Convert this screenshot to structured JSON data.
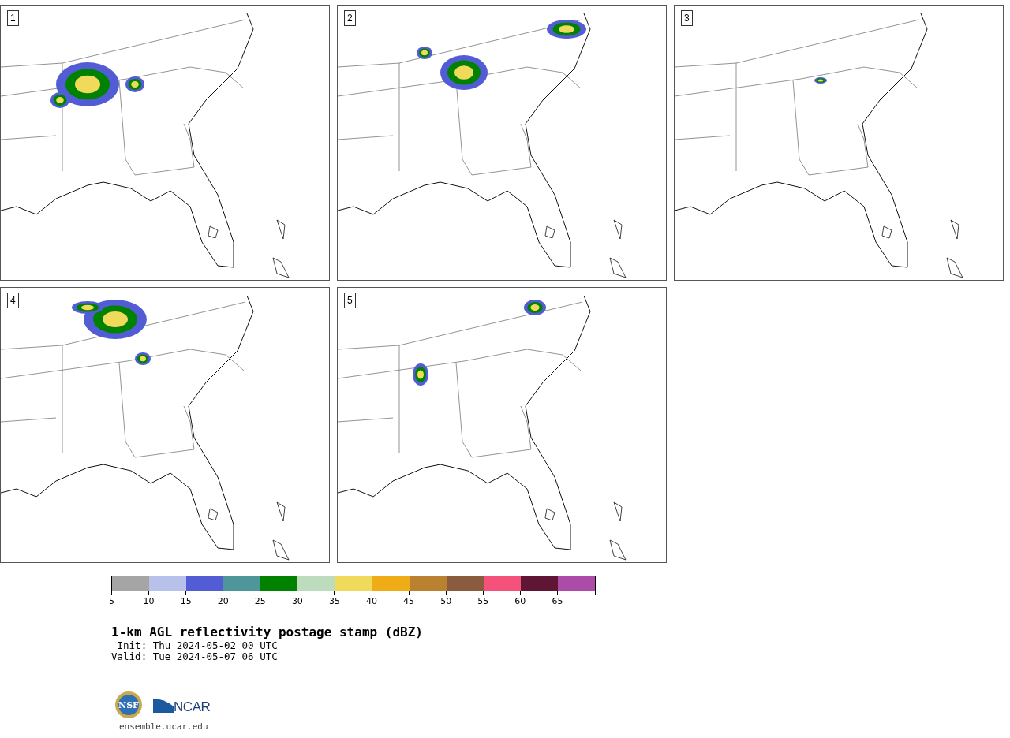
{
  "panels": [
    {
      "label": "1"
    },
    {
      "label": "2"
    },
    {
      "label": "3"
    },
    {
      "label": "4"
    },
    {
      "label": "5"
    }
  ],
  "colorbar": {
    "bins": [
      {
        "label": "5",
        "color": "#a5a5a5"
      },
      {
        "label": "10",
        "color": "#b7c1ea"
      },
      {
        "label": "15",
        "color": "#525dd5"
      },
      {
        "label": "20",
        "color": "#4e9699"
      },
      {
        "label": "25",
        "color": "#008200"
      },
      {
        "label": "30",
        "color": "#bddcbd"
      },
      {
        "label": "35",
        "color": "#f0da5c"
      },
      {
        "label": "40",
        "color": "#f0ac17"
      },
      {
        "label": "45",
        "color": "#b98130"
      },
      {
        "label": "50",
        "color": "#8a5b3e"
      },
      {
        "label": "55",
        "color": "#f4527a"
      },
      {
        "label": "60",
        "color": "#5f1634"
      },
      {
        "label": "65",
        "color": "#ad4ba8"
      }
    ]
  },
  "title": "1-km AGL reflectivity postage stamp (dBZ)",
  "init": " Init: Thu 2024-05-02 00 UTC",
  "valid": "Valid: Tue 2024-05-07 06 UTC",
  "logos": {
    "nsf": "NSF",
    "ncar": "NCAR"
  },
  "url": "ensemble.ucar.edu"
}
